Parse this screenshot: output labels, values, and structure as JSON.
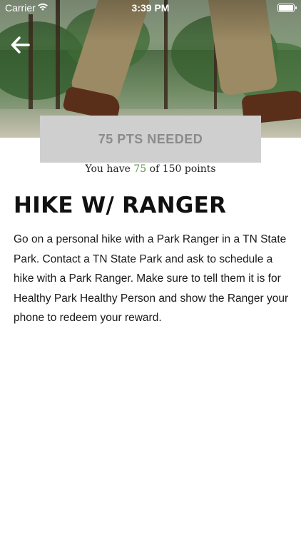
{
  "status_bar": {
    "carrier": "Carrier",
    "time": "3:39 PM",
    "wifi_icon": "wifi-icon",
    "battery_level": 1.0
  },
  "header": {
    "back_icon": "arrow-left-icon"
  },
  "reward": {
    "banner_label": "75 PTS NEEDED",
    "points_prefix": "You have",
    "points_current": "75",
    "points_suffix": "of 150 points",
    "title": "HIKE W/ RANGER",
    "description": "Go on a personal hike with a Park Ranger in a TN State Park. Contact a TN State Park and ask to schedule a hike with a Park Ranger. Make sure to tell them it is for Healthy Park Healthy Person and show the Ranger your phone to redeem your reward."
  },
  "colors": {
    "points_accent": "#5a9a4c",
    "banner_bg": "#cfcfcf",
    "banner_text": "#8b8b8b"
  }
}
